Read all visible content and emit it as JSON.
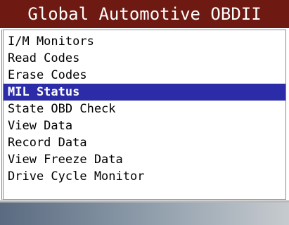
{
  "title": "Global Automotive OBDII",
  "menu": {
    "items": [
      {
        "label": "I/M Monitors"
      },
      {
        "label": "Read Codes"
      },
      {
        "label": "Erase Codes"
      },
      {
        "label": "MIL Status"
      },
      {
        "label": "State OBD Check"
      },
      {
        "label": "View Data"
      },
      {
        "label": "Record Data"
      },
      {
        "label": "View Freeze Data"
      },
      {
        "label": "Drive Cycle Monitor"
      }
    ],
    "selected_index": 3
  },
  "colors": {
    "title_bg": "#6e1a12",
    "highlight_bg": "#2c2ca8"
  }
}
